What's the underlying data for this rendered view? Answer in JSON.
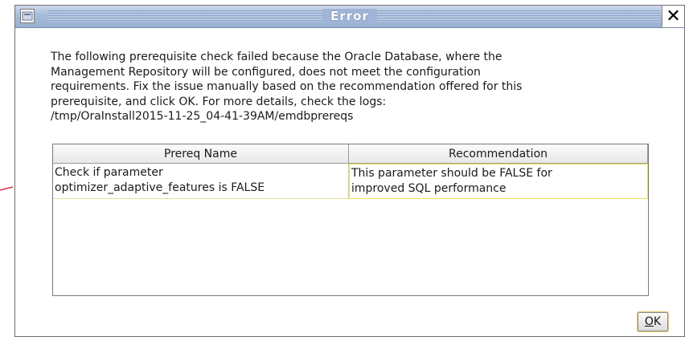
{
  "dialog": {
    "title": "Error",
    "close_symbol": "✕",
    "message_lines": [
      "The following prerequisite check failed because the Oracle Database, where the",
      "Management Repository will be configured, does not meet the configuration",
      "requirements. Fix the issue manually based on the recommendation offered for this",
      "prerequisite, and click OK. For more details, check the logs:",
      "/tmp/OraInstall2015-11-25_04-41-39AM/emdbprereqs"
    ]
  },
  "table": {
    "headers": [
      "Prereq Name",
      "Recommendation"
    ],
    "rows": [
      {
        "name_lines": [
          "Check if parameter",
          "optimizer_adaptive_features is FALSE"
        ],
        "recommendation_lines": [
          "This parameter should be FALSE for",
          "improved SQL performance"
        ]
      }
    ]
  },
  "buttons": {
    "ok_mnemonic": "O",
    "ok_rest": "K"
  },
  "icons": {
    "window": "app-window-icon",
    "close": "close-icon",
    "annotation": "red-arrow-icon"
  },
  "colors": {
    "titlebar": "#a9bdda",
    "annotation_arrow": "#e0304a",
    "row_highlight_border": "#e9e25a"
  }
}
